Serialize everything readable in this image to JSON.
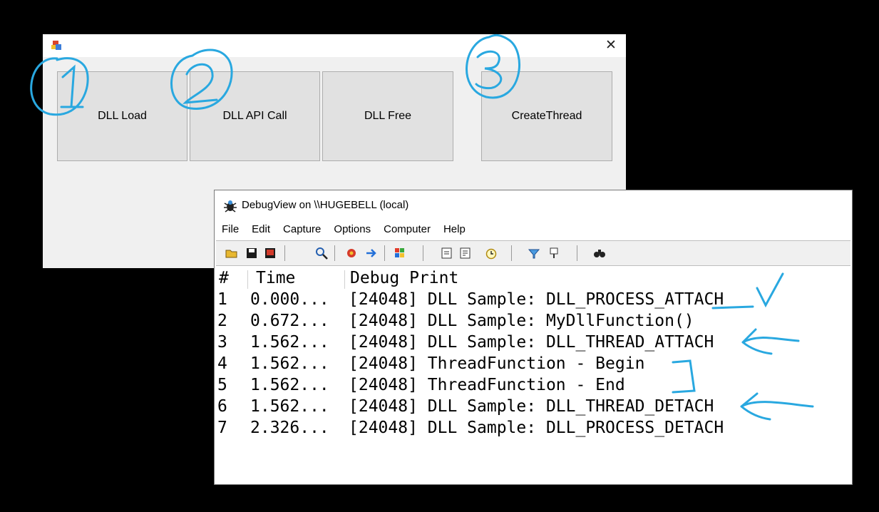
{
  "app_window": {
    "close_glyph": "✕",
    "buttons": [
      {
        "label": "DLL Load"
      },
      {
        "label": "DLL API Call"
      },
      {
        "label": "DLL Free"
      },
      {
        "label": "CreateThread"
      }
    ]
  },
  "debugview": {
    "title": "DebugView on \\\\HUGEBELL (local)",
    "menu": [
      "File",
      "Edit",
      "Capture",
      "Options",
      "Computer",
      "Help"
    ],
    "columns": {
      "num": "#",
      "time": "Time",
      "message": "Debug Print"
    },
    "rows": [
      {
        "num": "1",
        "time": "0.000...",
        "message": "[24048] DLL Sample: DLL_PROCESS_ATTACH"
      },
      {
        "num": "2",
        "time": "0.672...",
        "message": "[24048] DLL Sample: MyDllFunction()"
      },
      {
        "num": "3",
        "time": "1.562...",
        "message": "[24048] DLL Sample: DLL_THREAD_ATTACH"
      },
      {
        "num": "4",
        "time": "1.562...",
        "message": "[24048] ThreadFunction - Begin"
      },
      {
        "num": "5",
        "time": "1.562...",
        "message": "[24048] ThreadFunction - End"
      },
      {
        "num": "6",
        "time": "1.562...",
        "message": "[24048] DLL Sample: DLL_THREAD_DETACH"
      },
      {
        "num": "7",
        "time": "2.326...",
        "message": "[24048] DLL Sample: DLL_PROCESS_DETACH"
      }
    ]
  },
  "annotations": {
    "circled_numbers": [
      "1",
      "2",
      "3"
    ],
    "ink_color": "#29a8e0"
  },
  "colors": {
    "background": "#000000",
    "window": "#f0f0f0",
    "button": "#e1e1e1"
  }
}
